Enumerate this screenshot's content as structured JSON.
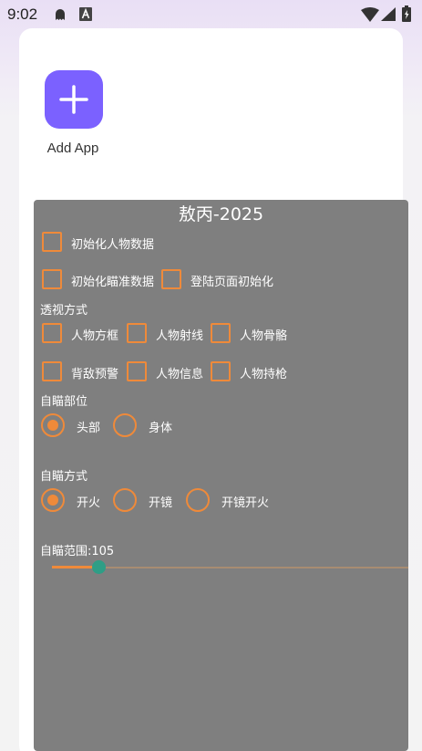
{
  "status_bar": {
    "time": "9:02"
  },
  "launcher": {
    "add_app_label": "Add App"
  },
  "panel": {
    "title": "敖丙-2025",
    "init": {
      "init_character": "初始化人物数据",
      "init_aim": "初始化瞄准数据",
      "login_init": "登陆页面初始化"
    },
    "esp": {
      "section": "透视方式",
      "box": "人物方框",
      "line": "人物射线",
      "skeleton": "人物骨骼",
      "back_warning": "背敌预警",
      "info": "人物信息",
      "weapon": "人物持枪"
    },
    "aim_part": {
      "section": "自瞄部位",
      "head": "头部",
      "body": "身体",
      "selected": "头部"
    },
    "aim_mode": {
      "section": "自瞄方式",
      "fire": "开火",
      "scope": "开镜",
      "scope_fire": "开镜开火",
      "selected": "开火"
    },
    "aim_range": {
      "label": "自瞄范围:105",
      "value": 105,
      "min": 0,
      "max": 800
    }
  },
  "colors": {
    "accent": "#ef8a3a",
    "panel_bg": "#7f7f7f",
    "thumb": "#2e9e86",
    "add_app_bg": "#7b61ff"
  },
  "icons": [
    "ghost-icon",
    "font-a-icon",
    "wifi-icon",
    "signal-icon",
    "battery-icon",
    "plus-icon"
  ]
}
